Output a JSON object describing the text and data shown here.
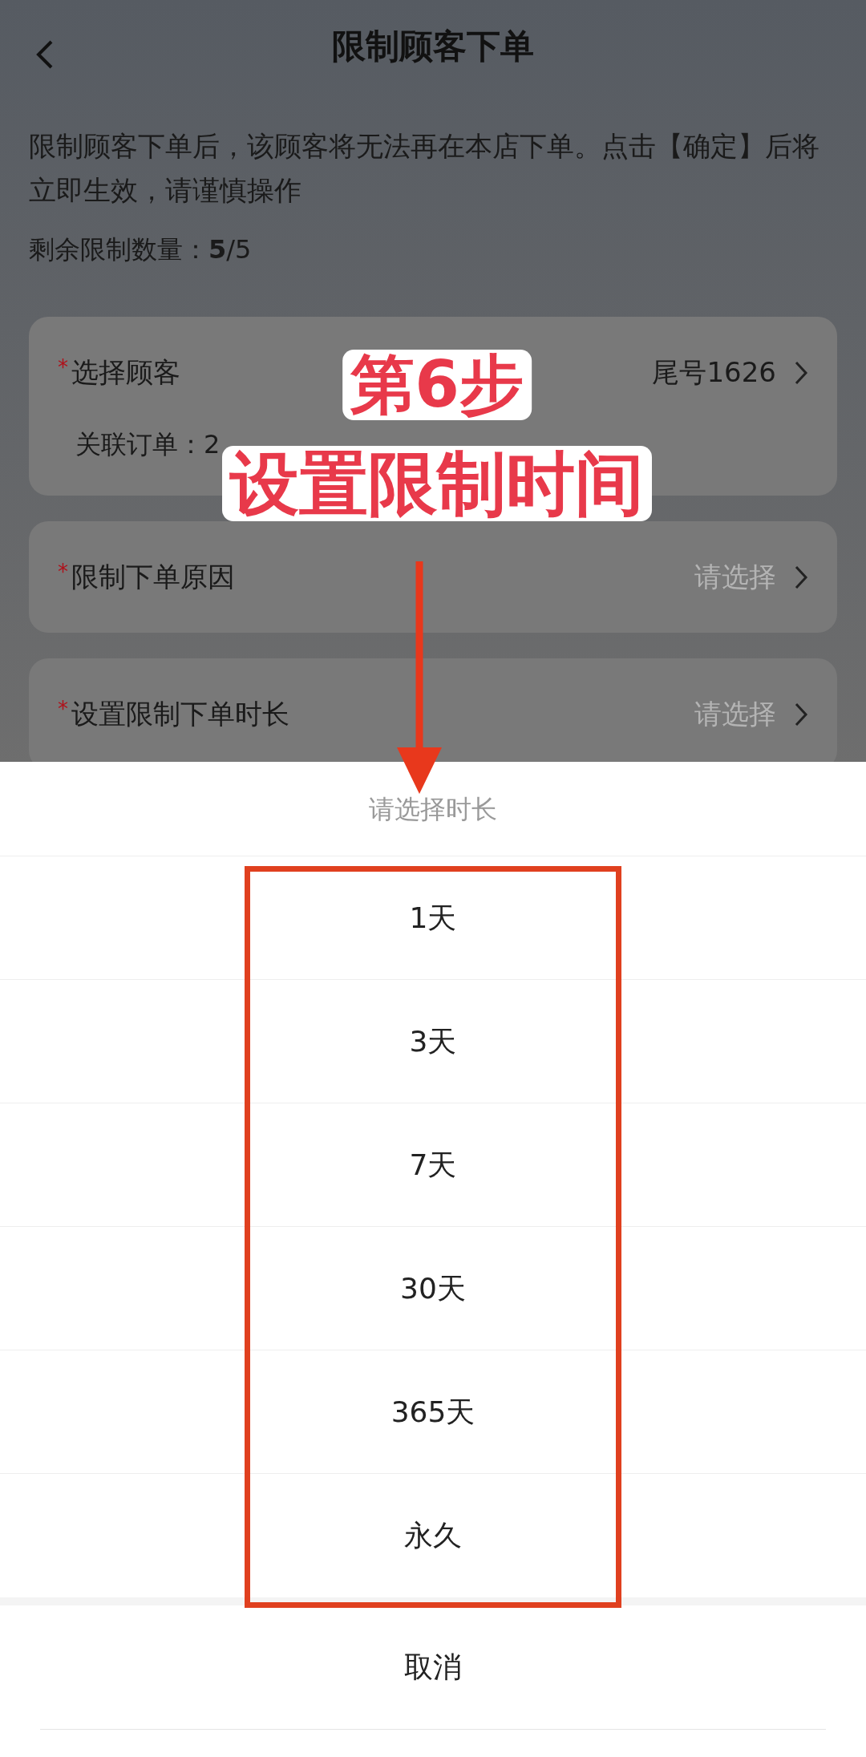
{
  "header": {
    "title": "限制顾客下单"
  },
  "notice": "限制顾客下单后，该顾客将无法再在本店下单。点击【确定】后将立即生效，请谨慎操作",
  "remaining": "剩余限制数量：**5**/5",
  "form": [
    {
      "required_mark": "*",
      "label": "选择顾客",
      "value": "尾号1626",
      "sub": "关联订单：2"
    },
    {
      "required_mark": "*",
      "label": "限制下单原因",
      "placeholder": "请选择"
    },
    {
      "required_mark": "*",
      "label": "设置限制下单时长",
      "placeholder": "请选择"
    }
  ],
  "sheet": {
    "title": "请选择时长",
    "options": [
      "1天",
      "3天",
      "7天",
      "30天",
      "365天",
      "永久"
    ],
    "cancel": "取消"
  },
  "annotation": {
    "step": "第6步",
    "caption": "设置限制时间"
  }
}
